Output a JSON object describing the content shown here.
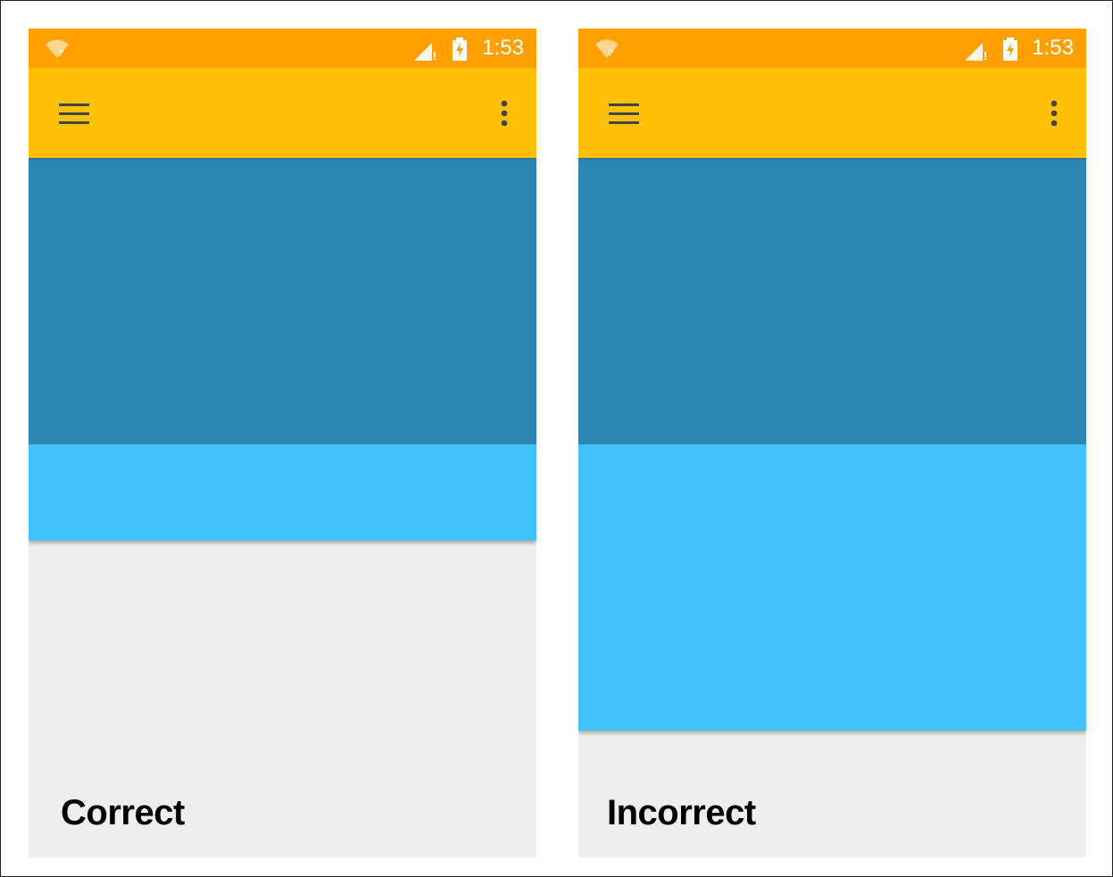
{
  "colors": {
    "status_bar": "#ffa000",
    "toolbar": "#ffc107",
    "content_dark": "#2e86b2",
    "content_light": "#42c3fd",
    "background": "#eeeeee"
  },
  "icons": {
    "wifi": "wifi-icon",
    "signal": "signal-icon",
    "battery": "battery-charging-icon",
    "menu": "hamburger-menu-icon",
    "overflow": "overflow-menu-icon"
  },
  "panels": [
    {
      "status_time": "1:53",
      "caption": "Correct"
    },
    {
      "status_time": "1:53",
      "caption": "Incorrect"
    }
  ]
}
